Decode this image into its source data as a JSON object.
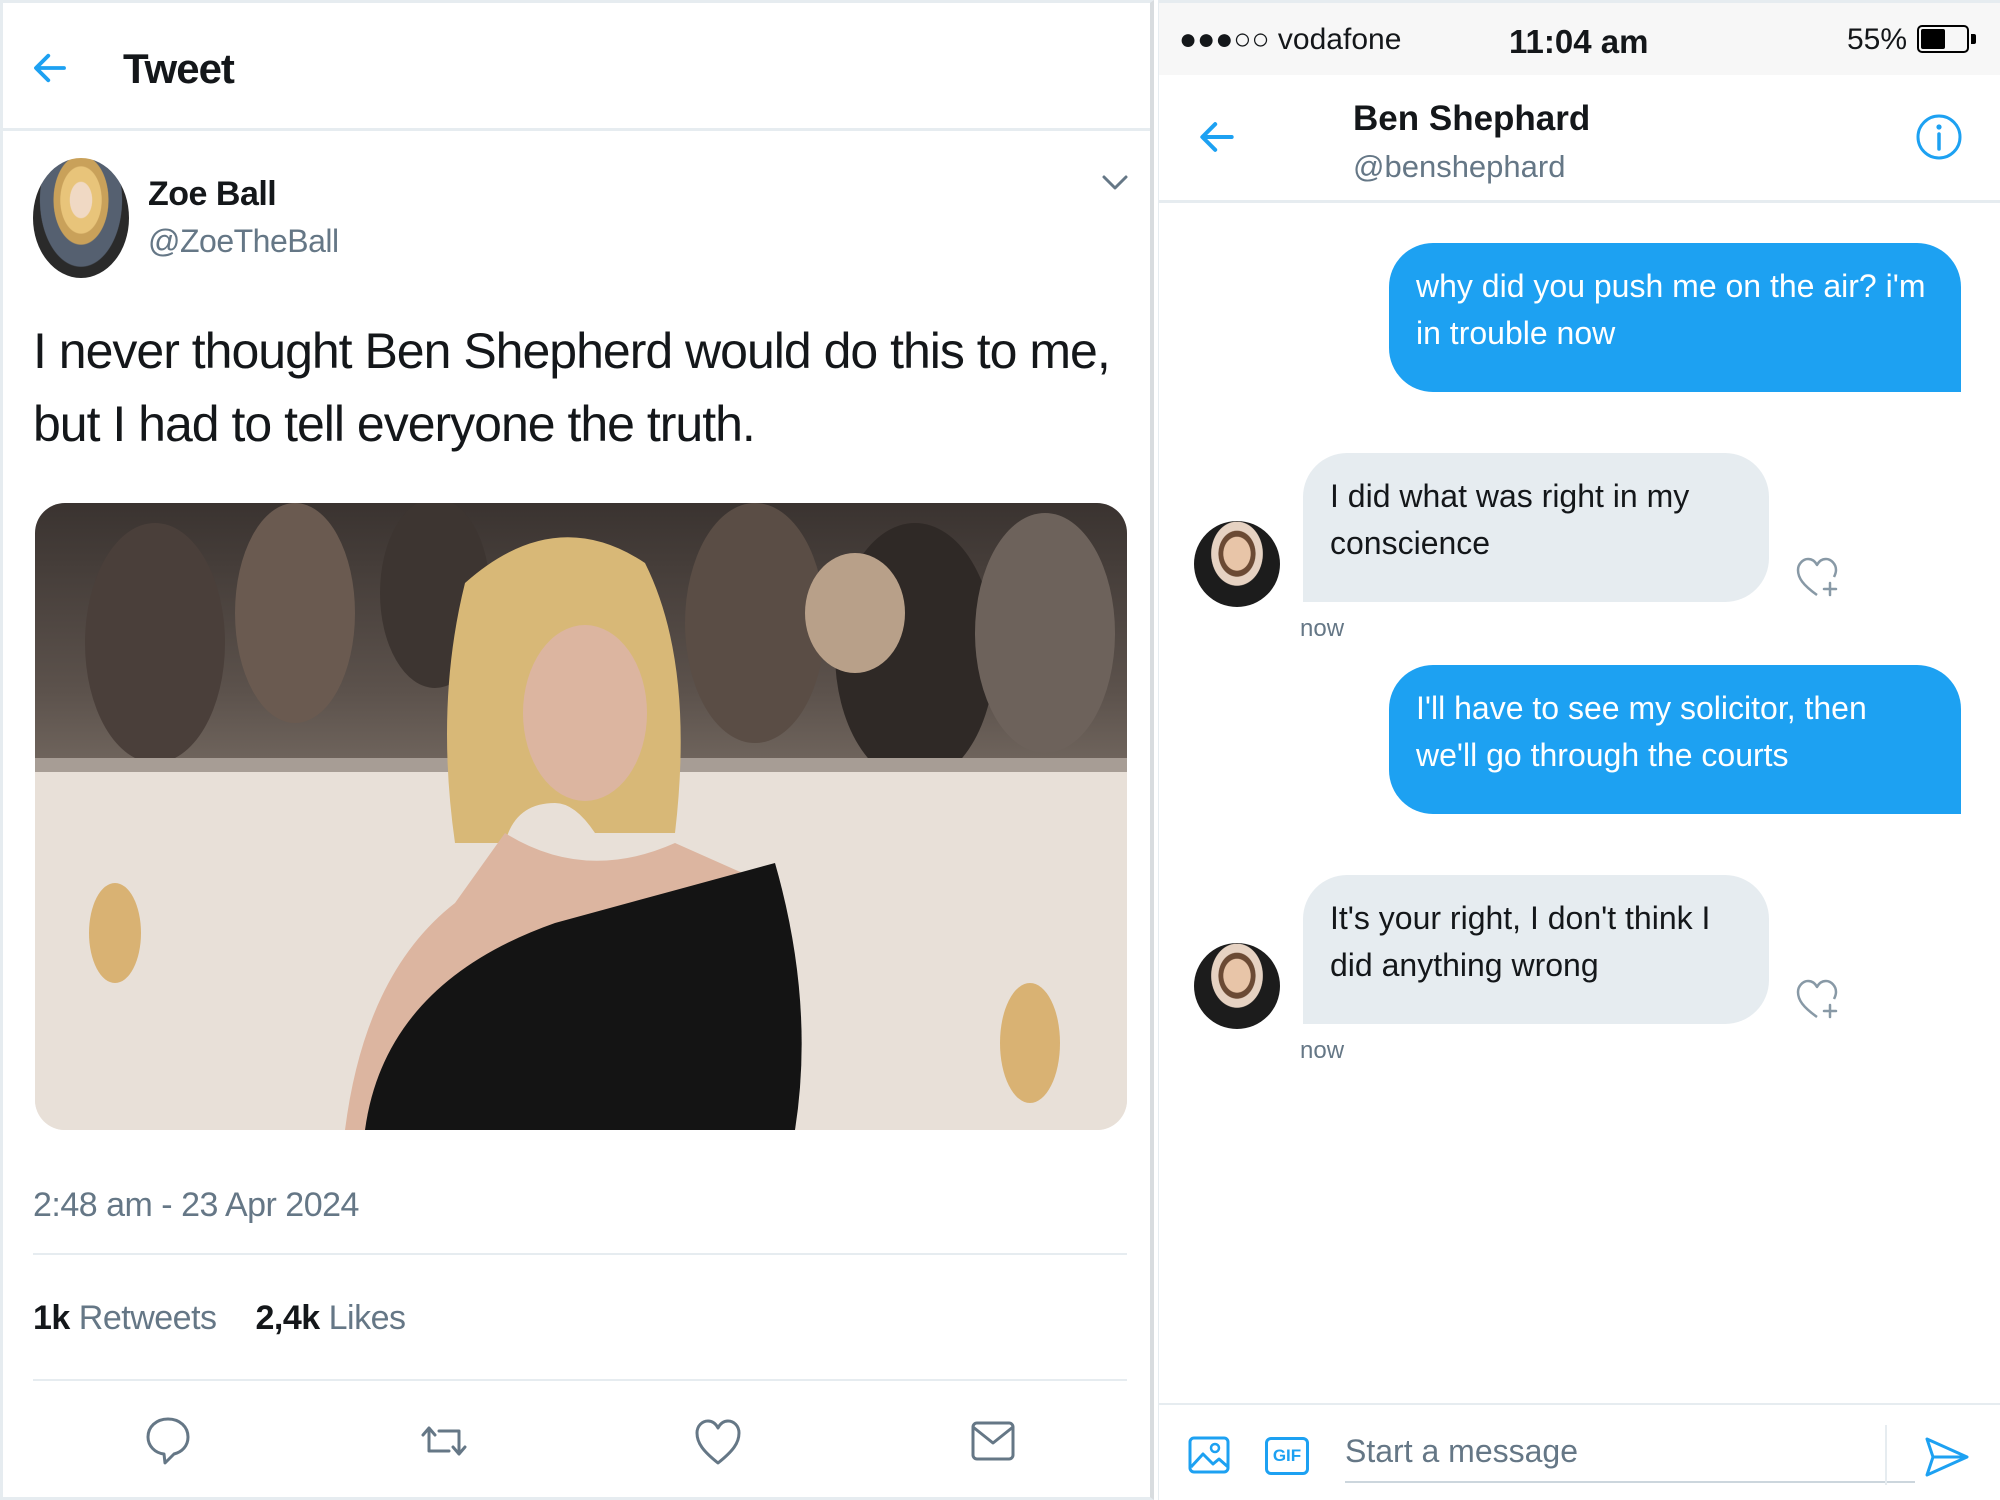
{
  "tweet": {
    "header": {
      "title": "Tweet"
    },
    "author": {
      "name": "Zoe Ball",
      "handle": "@ZoeTheBall"
    },
    "text": "I never thought Ben Shepherd would do this to me, but I had to tell everyone the truth.",
    "timestamp": "2:48 am - 23 Apr 2024",
    "stats": {
      "retweets_count": "1k",
      "retweets_label": "Retweets",
      "likes_count": "2,4k",
      "likes_label": "Likes"
    },
    "actions": [
      "reply-icon",
      "retweet-icon",
      "like-icon",
      "share-icon"
    ],
    "colors": {
      "accent": "#1da1f2",
      "secondary_text": "#657786"
    }
  },
  "status_bar": {
    "carrier": "●●●○○ vodafone",
    "time": "11:04 am",
    "battery": "55%",
    "battery_level": 0.55
  },
  "dm": {
    "contact": {
      "name": "Ben Shephard",
      "handle": "@benshephard"
    },
    "messages": [
      {
        "direction": "out",
        "text": "why did you push me on the air? i'm in trouble now"
      },
      {
        "direction": "in",
        "text": "I did what was right in my conscience",
        "time": "now"
      },
      {
        "direction": "out",
        "text": "I'll have to see my solicitor, then we'll go through the courts"
      },
      {
        "direction": "in",
        "text": "It's your right, I don't think I did anything wrong",
        "time": "now"
      }
    ],
    "composer": {
      "placeholder": "Start a message",
      "gif_label": "GIF"
    }
  }
}
